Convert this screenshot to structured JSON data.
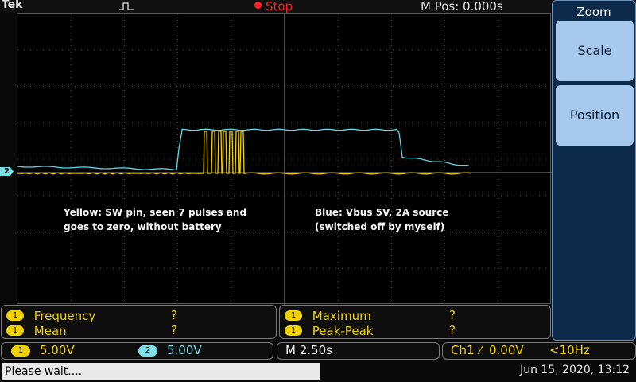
{
  "topbar": {
    "brand": "Tek",
    "trigger_icon": "pulse-trigger-icon",
    "run_state": "Stop",
    "run_color": "#ff2020",
    "horizontal_position": "M Pos: 0.000s"
  },
  "channel_marker": "2",
  "annotations": {
    "yellow": "Yellow: SW pin, seen 7 pulses and goes to zero, without battery",
    "blue": "Blue: Vbus 5V, 2A source (switched off by myself)"
  },
  "side_menu": {
    "title": "Zoom",
    "buttons": [
      "Scale",
      "Position"
    ]
  },
  "measurements": {
    "left": [
      {
        "channel": "1",
        "name": "Frequency",
        "value": "?"
      },
      {
        "channel": "1",
        "name": "Mean",
        "value": "?"
      }
    ],
    "right": [
      {
        "channel": "1",
        "name": "Maximum",
        "value": "?"
      },
      {
        "channel": "1",
        "name": "Peak-Peak",
        "value": "?"
      }
    ]
  },
  "status": {
    "ch1": {
      "label": "1",
      "scale": "5.00V",
      "color": "#f0d200"
    },
    "ch2": {
      "label": "2",
      "scale": "5.00V",
      "color": "#7fe0e8"
    },
    "timebase": "M 2.50s",
    "trigger": {
      "source": "Ch1",
      "slope": "⁄",
      "level": "0.00V",
      "freq": "<10Hz"
    }
  },
  "bottom": {
    "message": "Please wait....",
    "datetime": "Jun 15, 2020, 13:12"
  },
  "colors": {
    "ch1": "#f0d200",
    "ch2": "#59d8e6",
    "grid": "#5c5c5c"
  }
}
